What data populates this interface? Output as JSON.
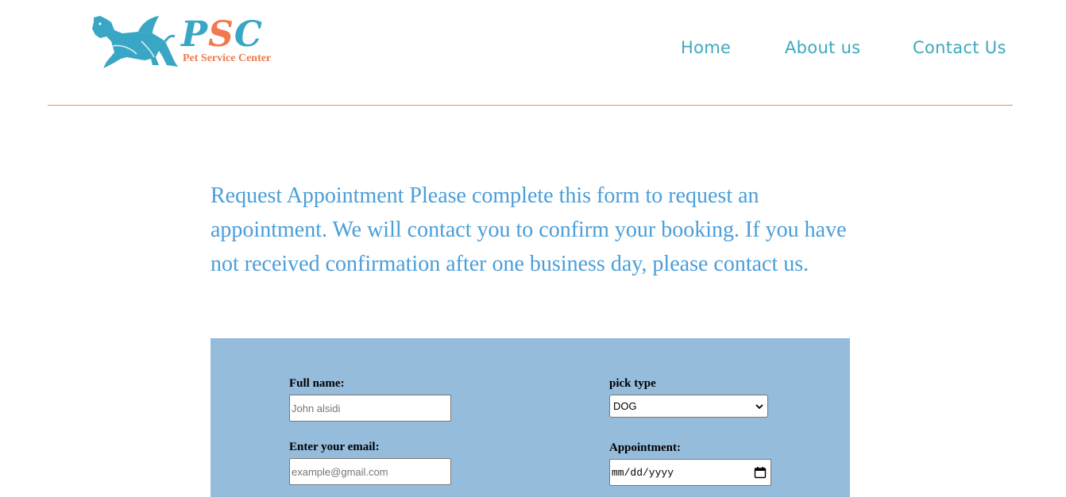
{
  "header": {
    "logo": {
      "letters": [
        "P",
        "S",
        "C"
      ],
      "subtitle": "Pet Service Center",
      "colors": {
        "teal": "#38a6c4",
        "orange": "#f07a4d"
      }
    },
    "nav": {
      "items": [
        {
          "label": "Home"
        },
        {
          "label": "About us"
        },
        {
          "label": "Contact Us"
        }
      ],
      "color": "#3ca9bf"
    },
    "divider_color": "#ef8a5c"
  },
  "intro": {
    "text": "Request Appointment Please complete this form to request an appointment. We will contact you to confirm your booking. If you have not received confirmation after one business day, please contact us.",
    "color": "#4a9ed9"
  },
  "form": {
    "background": "#96bcdc",
    "full_name": {
      "label": "Full name:",
      "placeholder": "John alsidi",
      "value": ""
    },
    "email": {
      "label": "Enter your email:",
      "placeholder": "example@gmail.com",
      "value": ""
    },
    "pet_type": {
      "label": "pick type",
      "selected": "DOG"
    },
    "appointment": {
      "label": "Appointment:",
      "value": "mm/dd/yyyy"
    }
  }
}
